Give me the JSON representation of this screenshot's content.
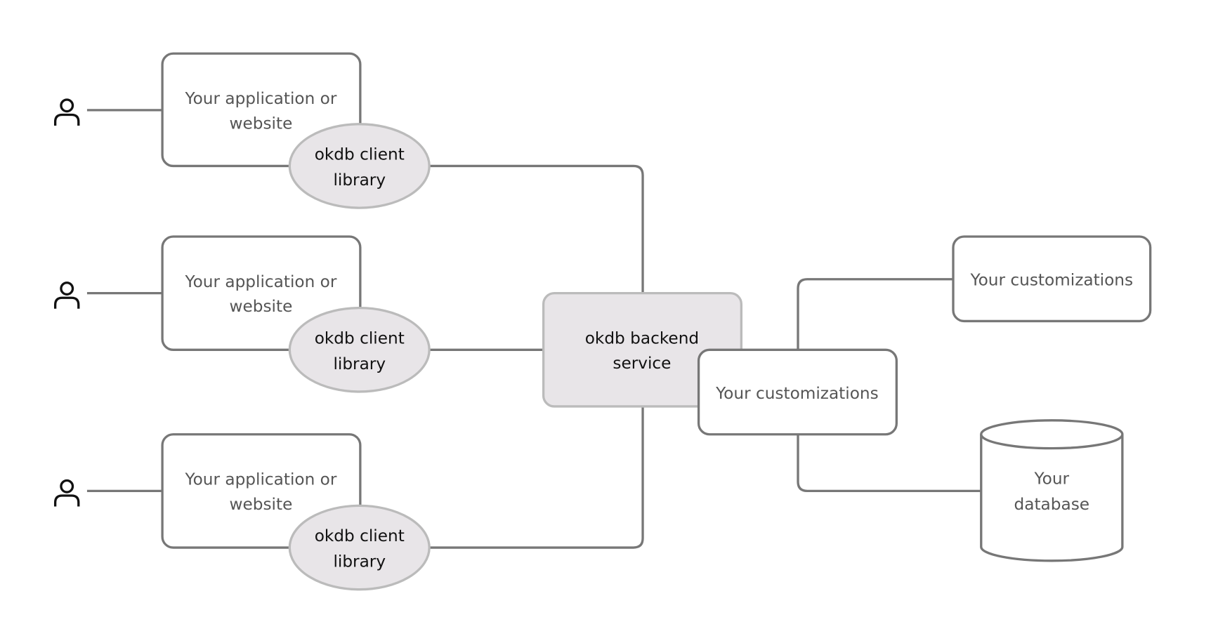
{
  "colors": {
    "box_stroke": "#777777",
    "shaded_fill": "#e8e5e8",
    "shaded_stroke": "#bbbbbb",
    "user_icon": "#111111"
  },
  "clients": [
    {
      "icon": "user-icon",
      "app_line1": "Your application or",
      "app_line2": "website",
      "lib_line1": "okdb client",
      "lib_line2": "library"
    },
    {
      "icon": "user-icon",
      "app_line1": "Your application or",
      "app_line2": "website",
      "lib_line1": "okdb client",
      "lib_line2": "library"
    },
    {
      "icon": "user-icon",
      "app_line1": "Your application or",
      "app_line2": "website",
      "lib_line1": "okdb client",
      "lib_line2": "library"
    }
  ],
  "backend": {
    "line1": "okdb backend",
    "line2": "service"
  },
  "customizations_main": "Your customizations",
  "customizations_top": "Your customizations",
  "database": {
    "line1": "Your",
    "line2": "database"
  }
}
